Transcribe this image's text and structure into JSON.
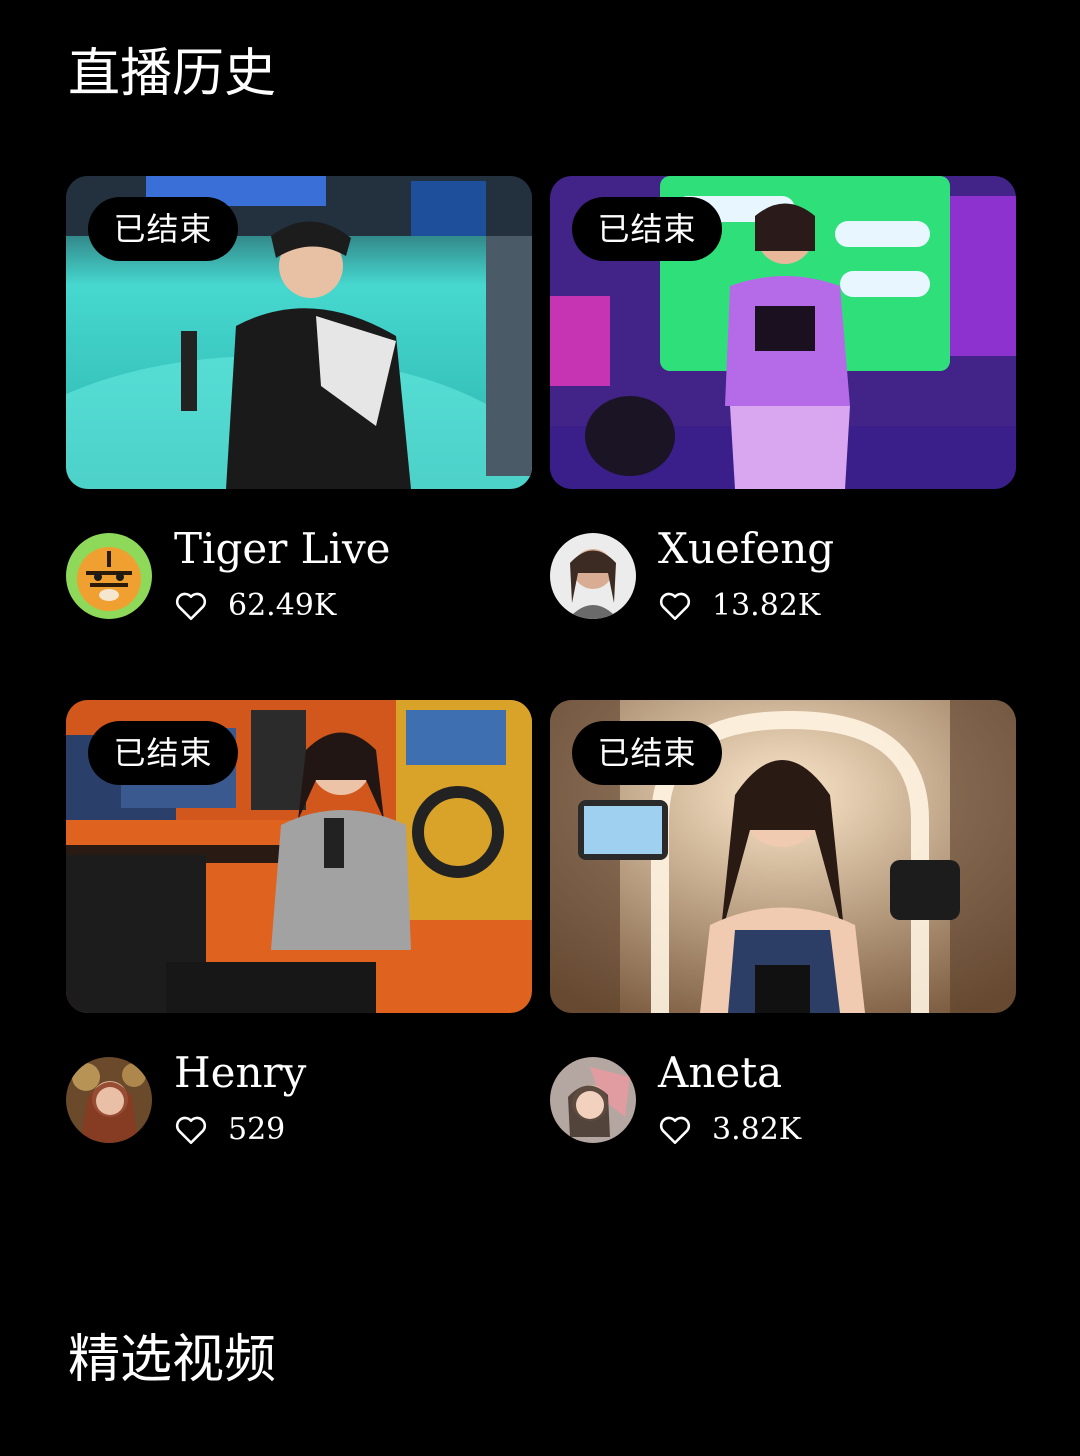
{
  "sections": {
    "history_title": "直播历史",
    "featured_title": "精选视频"
  },
  "cards": [
    {
      "status": "已结束",
      "author": "Tiger Live",
      "likes": "62.49K"
    },
    {
      "status": "已结束",
      "author": "Xuefeng",
      "likes": "13.82K"
    },
    {
      "status": "已结束",
      "author": "Henry",
      "likes": "529"
    },
    {
      "status": "已结束",
      "author": "Aneta",
      "likes": "3.82K"
    }
  ],
  "icons": {
    "like": "heart-outline-icon"
  },
  "colors": {
    "background": "#000000",
    "text": "#ffffff",
    "badge_bg": "#000000"
  }
}
